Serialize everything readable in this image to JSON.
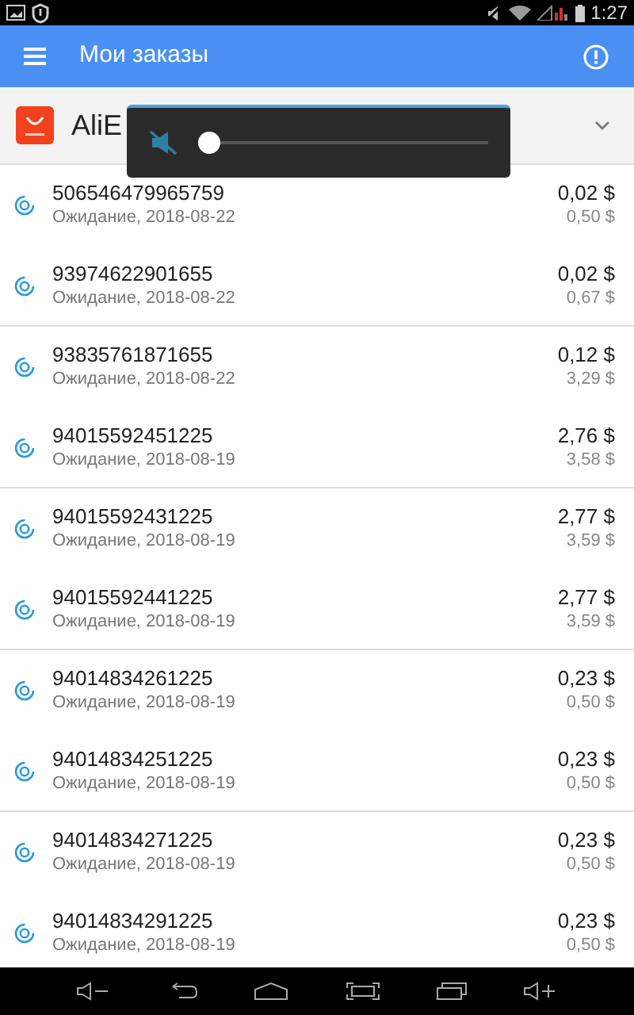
{
  "status_bar": {
    "time": "1:27"
  },
  "app_bar": {
    "title": "Мои заказы"
  },
  "store": {
    "name": "AliE"
  },
  "volume_popup": {
    "muted": true,
    "level": 0.0
  },
  "orders": [
    {
      "number": "506546479965759",
      "status": "Ожидание, 2018-08-22",
      "amount": "0,02 $",
      "total": "0,50 $"
    },
    {
      "number": "93974622901655",
      "status": "Ожидание, 2018-08-22",
      "amount": "0,02 $",
      "total": "0,67 $"
    },
    {
      "number": "93835761871655",
      "status": "Ожидание, 2018-08-22",
      "amount": "0,12 $",
      "total": "3,29 $"
    },
    {
      "number": "94015592451225",
      "status": "Ожидание, 2018-08-19",
      "amount": "2,76 $",
      "total": "3,58 $"
    },
    {
      "number": "94015592431225",
      "status": "Ожидание, 2018-08-19",
      "amount": "2,77 $",
      "total": "3,59 $"
    },
    {
      "number": "94015592441225",
      "status": "Ожидание, 2018-08-19",
      "amount": "2,77 $",
      "total": "3,59 $"
    },
    {
      "number": "94014834261225",
      "status": "Ожидание, 2018-08-19",
      "amount": "0,23 $",
      "total": "0,50 $"
    },
    {
      "number": "94014834251225",
      "status": "Ожидание, 2018-08-19",
      "amount": "0,23 $",
      "total": "0,50 $"
    },
    {
      "number": "94014834271225",
      "status": "Ожидание, 2018-08-19",
      "amount": "0,23 $",
      "total": "0,50 $"
    },
    {
      "number": "94014834291225",
      "status": "Ожидание, 2018-08-19",
      "amount": "0,23 $",
      "total": "0,50 $"
    }
  ]
}
